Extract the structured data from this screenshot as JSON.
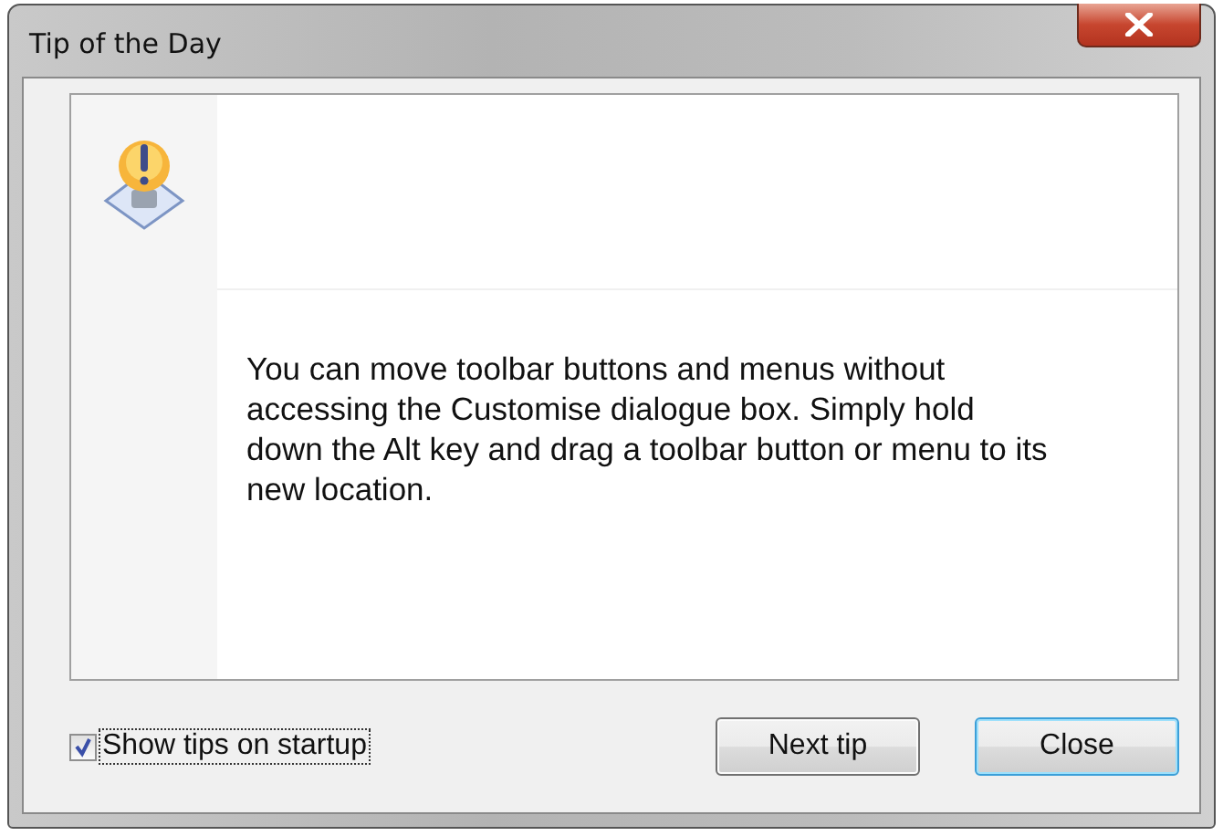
{
  "window": {
    "title": "Tip of the Day"
  },
  "tip": {
    "text": "You can move toolbar buttons and menus without accessing the Customise dialogue box. Simply hold down the Alt key and drag a toolbar button or menu to its new location."
  },
  "show_on_startup": {
    "label": "Show tips on startup",
    "checked": true
  },
  "buttons": [
    {
      "label": "Next tip",
      "default": false
    },
    {
      "label": "Close",
      "default": true
    }
  ]
}
